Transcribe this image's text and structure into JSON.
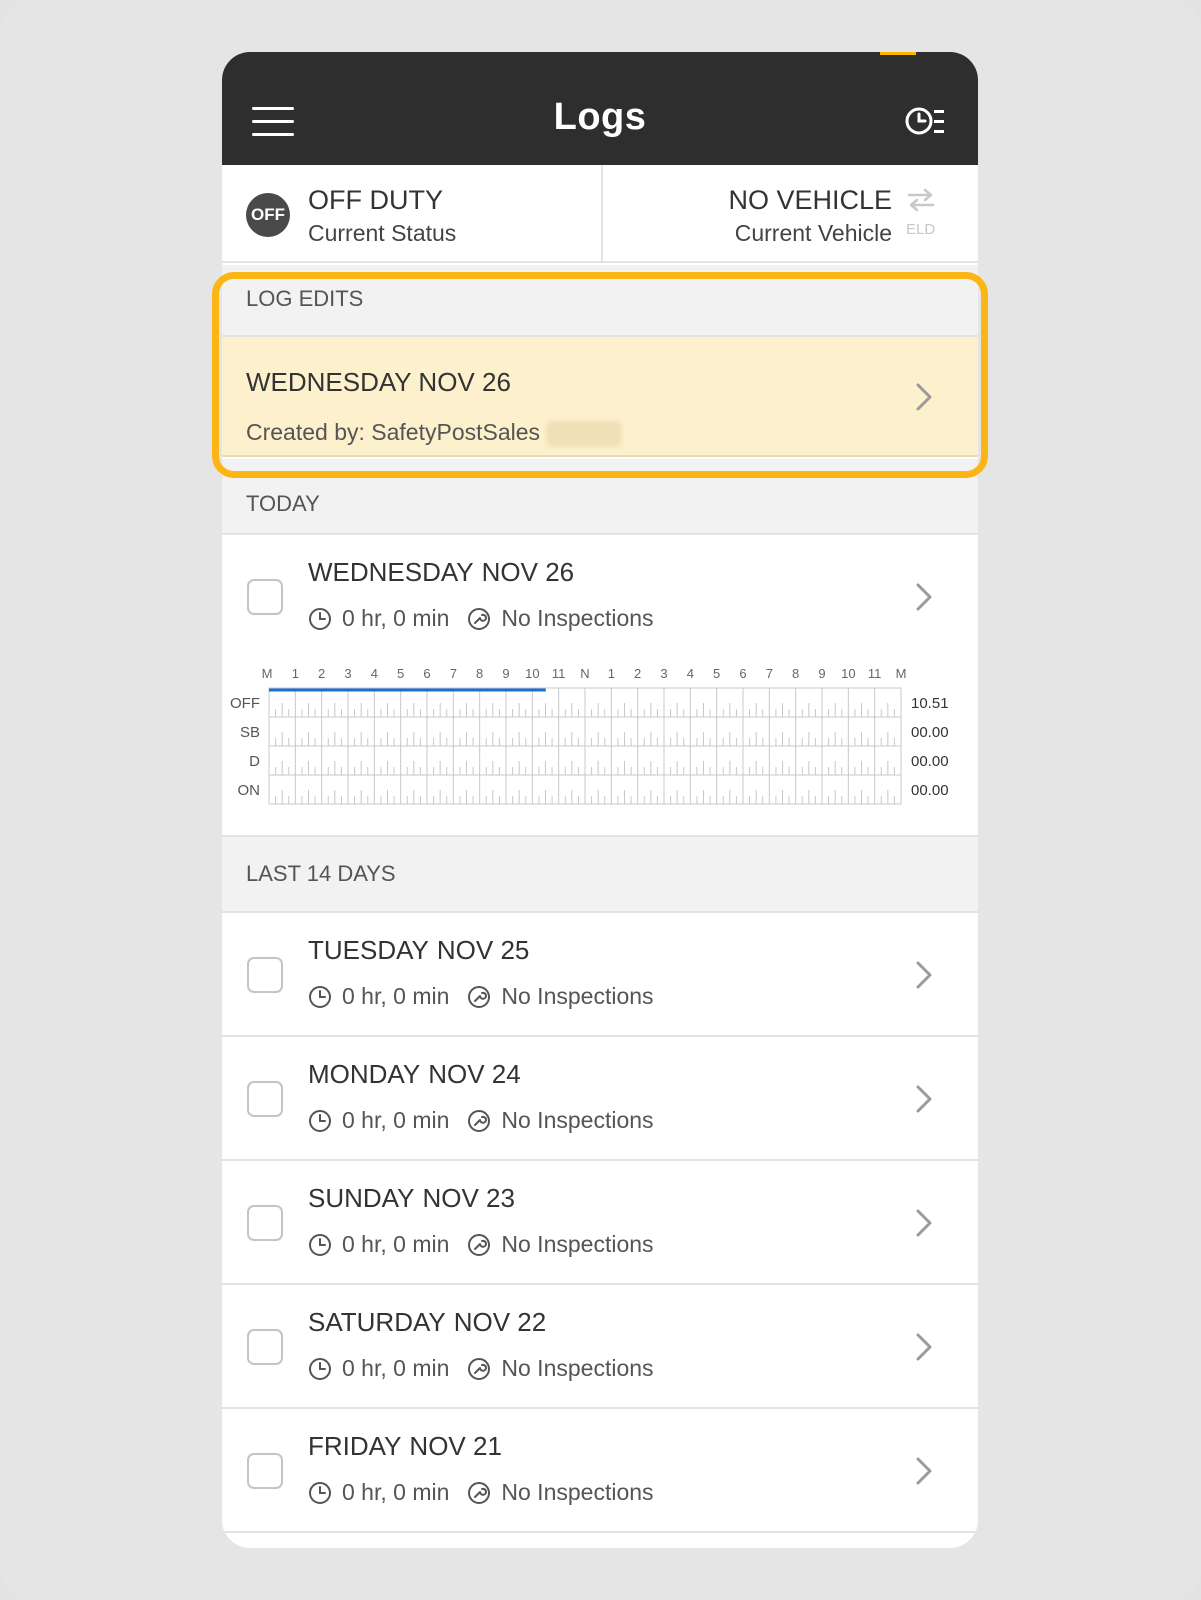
{
  "header": {
    "title": "Logs",
    "menu_icon": "hamburger-icon",
    "history_icon": "clock-list-icon"
  },
  "status": {
    "badge": "OFF",
    "duty_title": "OFF DUTY",
    "duty_sub": "Current Status",
    "vehicle_title": "NO VEHICLE",
    "vehicle_sub": "Current Vehicle",
    "eld_label": "ELD",
    "eld_icon": "swap-icon"
  },
  "log_edits": {
    "section_label": "LOG EDITS",
    "item": {
      "day": "WEDNESDAY",
      "date": "NOV 26",
      "created_by": "Created by: SafetyPostSales"
    }
  },
  "today": {
    "section_label": "TODAY",
    "day": "WEDNESDAY",
    "date": "NOV 26",
    "duration": "0 hr, 0 min",
    "inspections": "No Inspections"
  },
  "chart_data": {
    "type": "line",
    "hour_labels": [
      "M",
      "1",
      "2",
      "3",
      "4",
      "5",
      "6",
      "7",
      "8",
      "9",
      "10",
      "11",
      "N",
      "1",
      "2",
      "3",
      "4",
      "5",
      "6",
      "7",
      "8",
      "9",
      "10",
      "11",
      "M"
    ],
    "rows": [
      {
        "label": "OFF",
        "total": "10.51"
      },
      {
        "label": "SB",
        "total": "00.00"
      },
      {
        "label": "D",
        "total": "00.00"
      },
      {
        "label": "ON",
        "total": "00.00"
      }
    ],
    "segments": [
      {
        "status": "OFF",
        "start_hour": 0,
        "end_hour": 10.51
      }
    ],
    "line_color": "#1a6fd1"
  },
  "last14": {
    "section_label": "LAST 14 DAYS",
    "days": [
      {
        "day": "TUESDAY",
        "date": "NOV 25",
        "duration": "0 hr, 0 min",
        "inspections": "No Inspections"
      },
      {
        "day": "MONDAY",
        "date": "NOV 24",
        "duration": "0 hr, 0 min",
        "inspections": "No Inspections"
      },
      {
        "day": "SUNDAY",
        "date": "NOV 23",
        "duration": "0 hr, 0 min",
        "inspections": "No Inspections"
      },
      {
        "day": "SATURDAY",
        "date": "NOV 22",
        "duration": "0 hr, 0 min",
        "inspections": "No Inspections"
      },
      {
        "day": "FRIDAY",
        "date": "NOV 21",
        "duration": "0 hr, 0 min",
        "inspections": "No Inspections"
      }
    ]
  },
  "colors": {
    "header_bg": "#2e2e2e",
    "highlight": "#fbb514",
    "edit_bg": "#fdf0cc"
  }
}
